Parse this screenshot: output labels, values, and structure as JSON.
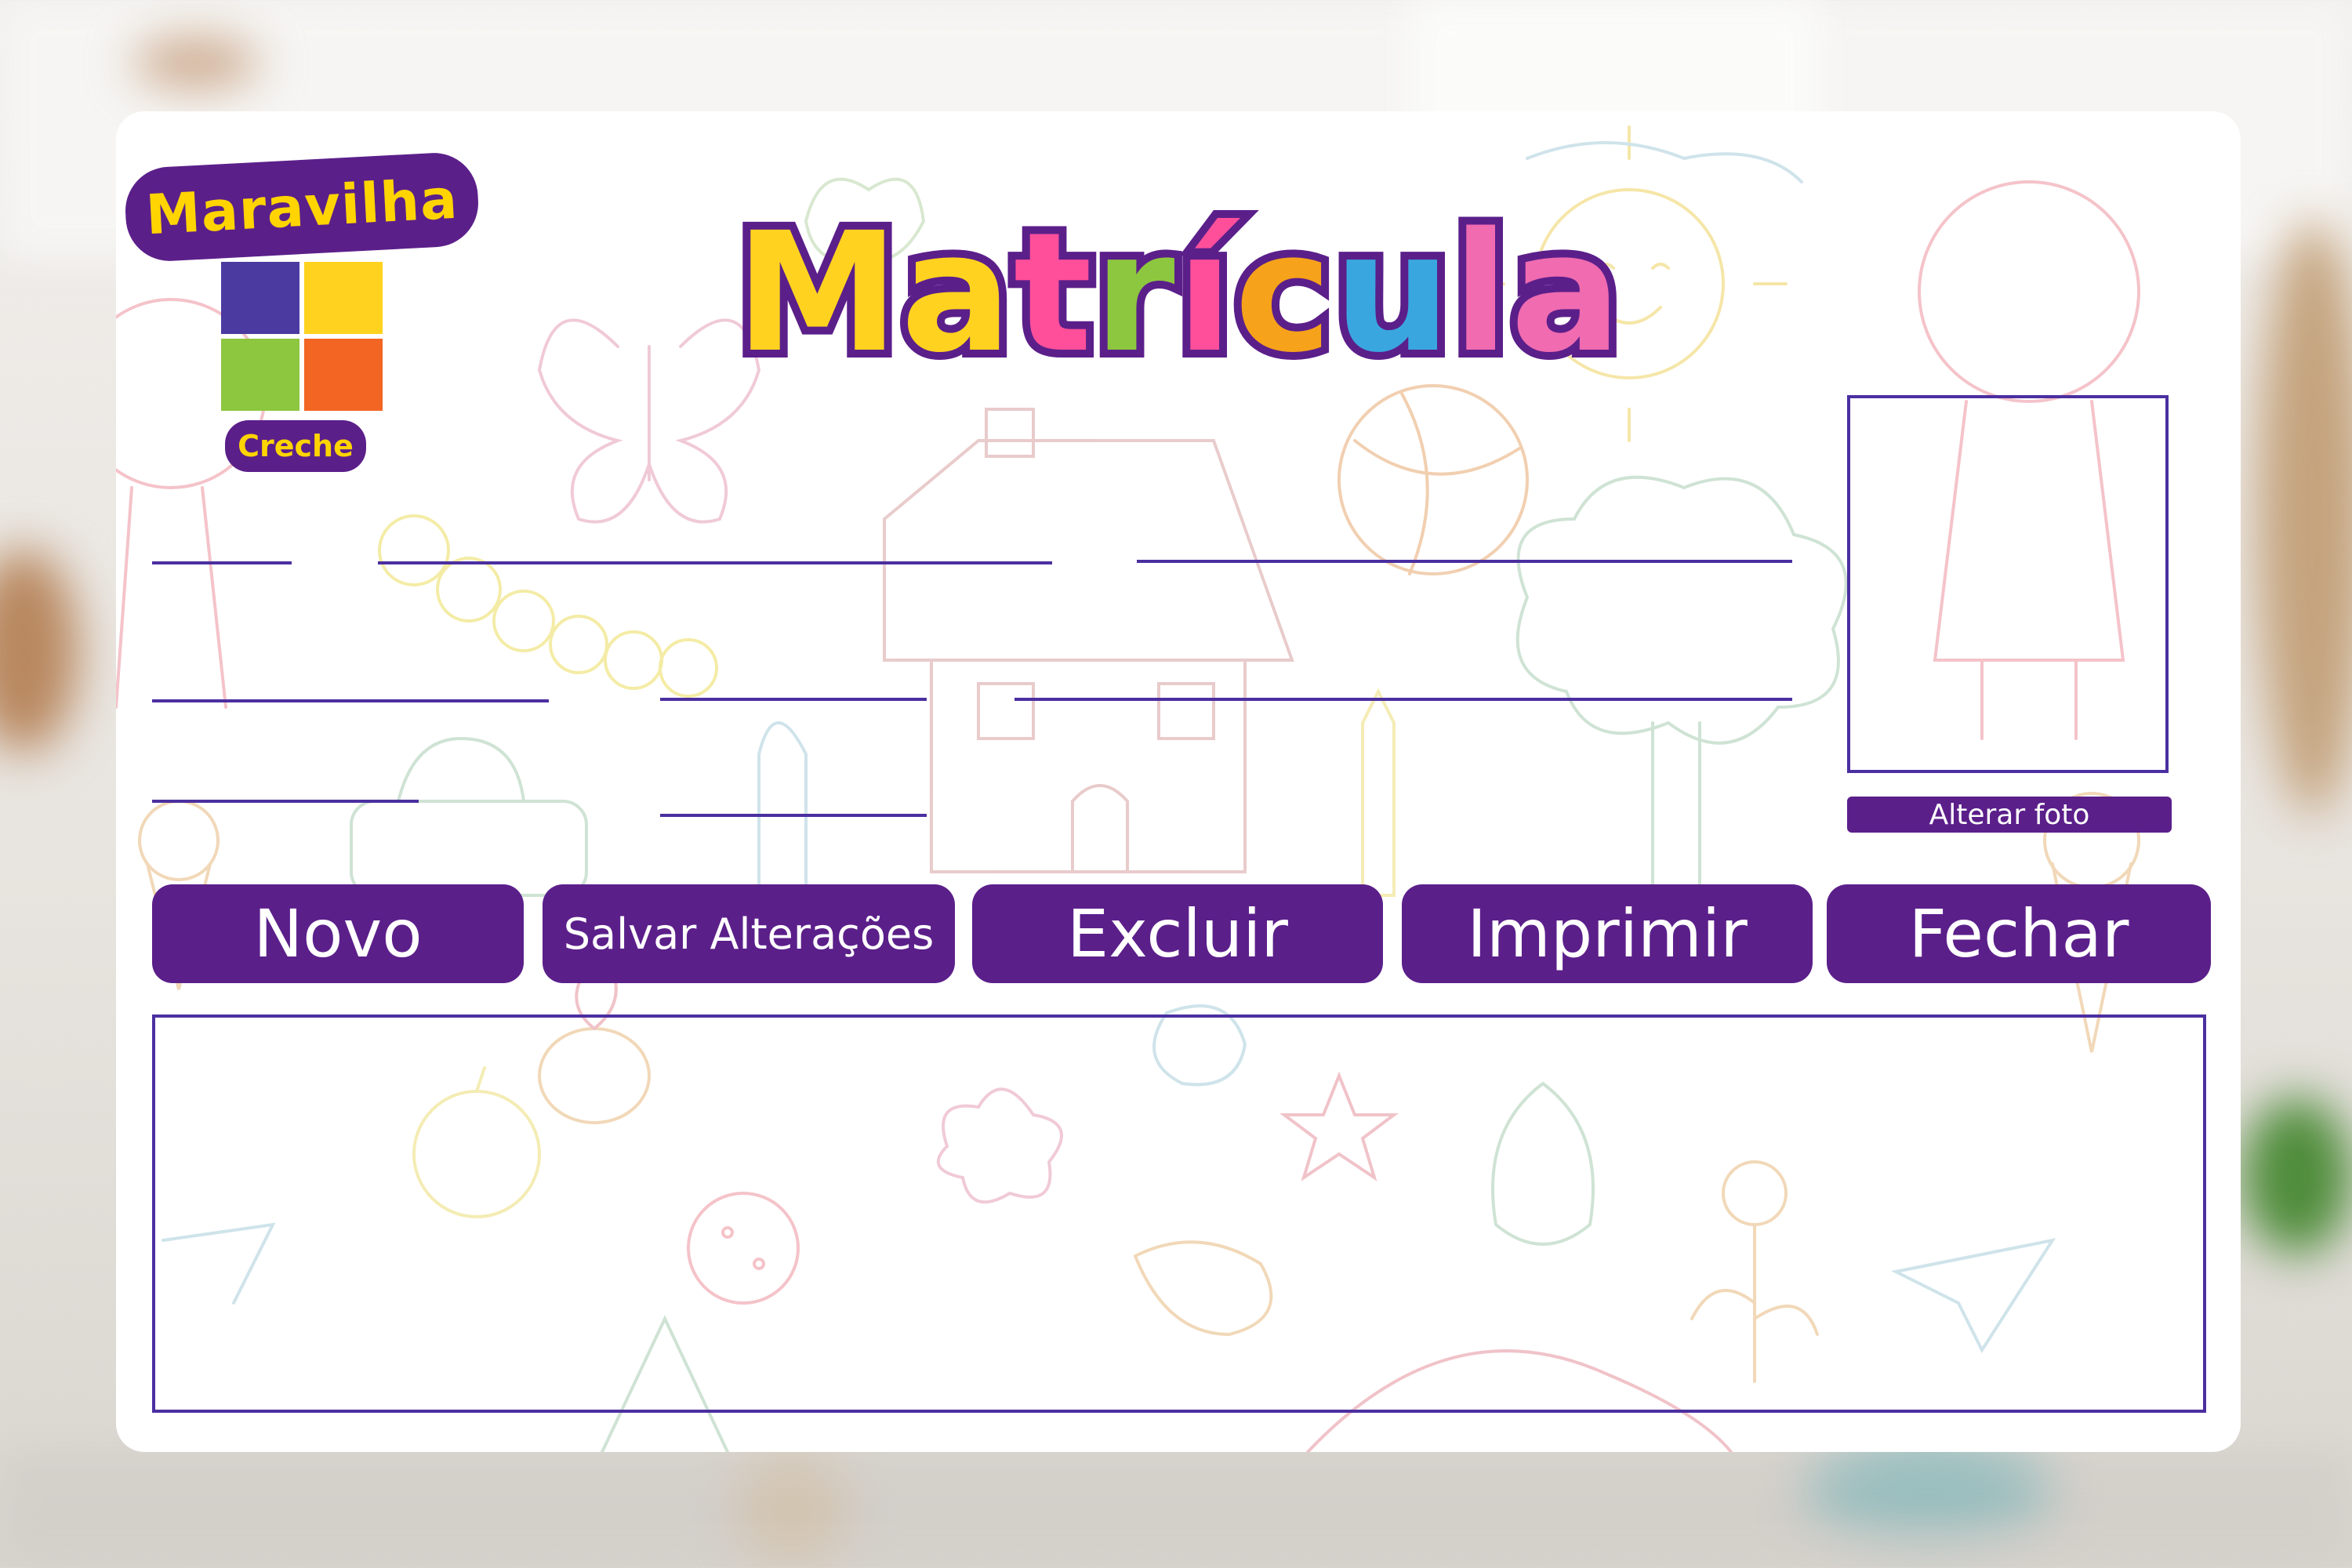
{
  "brand": {
    "logo_name": "Maravilha",
    "logo_sub": "Creche"
  },
  "title": {
    "letters": [
      "M",
      "a",
      "t",
      "r",
      "í",
      "c",
      "u",
      "l",
      "a"
    ],
    "letter_colors": [
      "#ffd21f",
      "#ffd21f",
      "#ff4f9a",
      "#8dc63f",
      "#ff4f9a",
      "#f6a21a",
      "#3aa6e0",
      "#f06bb0",
      "#f06bb0"
    ],
    "outline_color": "#5b1f8a"
  },
  "photo": {
    "change_button_label": "Alterar foto"
  },
  "actions": {
    "new_label": "Novo",
    "save_label": "Salvar Alterações",
    "delete_label": "Excluir",
    "print_label": "Imprimir",
    "close_label": "Fechar"
  },
  "colors": {
    "primary": "#5b1f8a",
    "field_line": "#4b2fa0",
    "card": "#ffffff"
  }
}
